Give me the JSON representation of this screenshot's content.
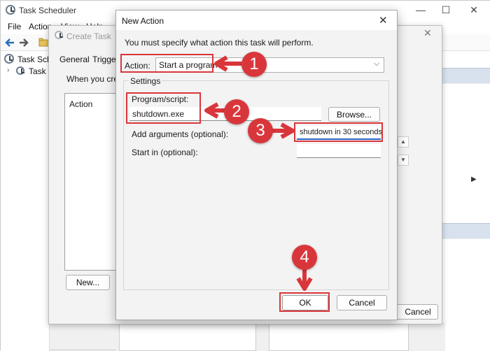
{
  "task_scheduler": {
    "title": "Task Scheduler",
    "menu": [
      "File",
      "Action",
      "View",
      "Help"
    ],
    "tree": [
      "Task Schedu",
      "Task Sc"
    ]
  },
  "create_task": {
    "title": "Create Task",
    "tabs": [
      "General",
      "Triggers"
    ],
    "description": "When you crea",
    "list_header": "Action",
    "new_button": "New...",
    "cancel_button": "Cancel"
  },
  "new_action": {
    "title": "New Action",
    "description": "You must specify what action this task will perform.",
    "action_label": "Action:",
    "action_value": "Start a program",
    "settings_label": "Settings",
    "program_label": "Program/script:",
    "program_value": "shutdown.exe",
    "browse_button": "Browse...",
    "arguments_label": "Add arguments (optional):",
    "arguments_value": "shutdown in 30 seconds",
    "start_in_label": "Start in (optional):",
    "start_in_value": "",
    "ok_button": "OK",
    "cancel_button": "Cancel"
  },
  "callouts": [
    "1",
    "2",
    "3",
    "4"
  ],
  "colors": {
    "highlight": "#d9363b",
    "accent": "#2a66c4"
  }
}
